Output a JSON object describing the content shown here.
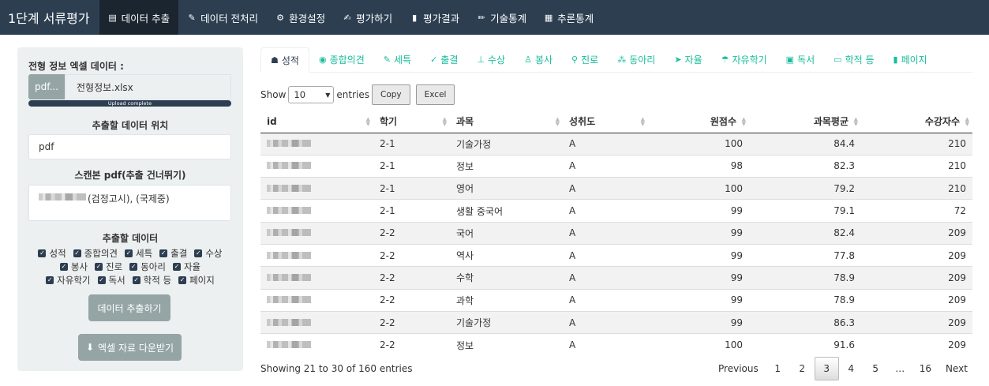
{
  "navbar": {
    "brand": "1단계 서류평가",
    "items": [
      {
        "label": "데이터 추출",
        "icon": "database-icon",
        "glyph": "▤"
      },
      {
        "label": "데이터 전처리",
        "icon": "magic-icon",
        "glyph": "✎"
      },
      {
        "label": "환경설정",
        "icon": "gears-icon",
        "glyph": "⚙"
      },
      {
        "label": "평가하기",
        "icon": "file-signature-icon",
        "glyph": "✍"
      },
      {
        "label": "평가결과",
        "icon": "book-icon",
        "glyph": "▮"
      },
      {
        "label": "기술통계",
        "icon": "pencil-icon",
        "glyph": "✏"
      },
      {
        "label": "추론통계",
        "icon": "chart-icon",
        "glyph": "▦"
      }
    ]
  },
  "sidebar": {
    "file_label": "전형 정보 엑셀 데이터 :",
    "file_button": "pdf...",
    "file_name": "전형정보.xlsx",
    "progress_text": "Upload complete",
    "location_label": "추출할 데이터 위치",
    "location_value": "pdf",
    "scan_label": "스캔본 pdf(추출 건너뛰기)",
    "scan_value": "(검정고시),  (국제중)",
    "extract_label": "추출할 데이터",
    "checkboxes_row1": [
      "성적",
      "종합의견",
      "세특",
      "출결",
      "수상"
    ],
    "checkboxes_row2": [
      "봉사",
      "진로",
      "동아리",
      "자율"
    ],
    "checkboxes_row3": [
      "자유학기",
      "독서",
      "학적 등",
      "페이지"
    ],
    "extract_button": "데이터 추출하기",
    "download_button": "엑셀 자료 다운받기"
  },
  "tabs": [
    {
      "label": "성적",
      "icon": "user-graduate-icon",
      "glyph": "☗"
    },
    {
      "label": "종합의견",
      "icon": "circle-user-icon",
      "glyph": "◉"
    },
    {
      "label": "세특",
      "icon": "edit-icon",
      "glyph": "✎"
    },
    {
      "label": "출결",
      "icon": "check-icon",
      "glyph": "✓"
    },
    {
      "label": "수상",
      "icon": "sitemap-icon",
      "glyph": "⊥"
    },
    {
      "label": "봉사",
      "icon": "hands-helping-icon",
      "glyph": "♙"
    },
    {
      "label": "진로",
      "icon": "route-icon",
      "glyph": "⚲"
    },
    {
      "label": "동아리",
      "icon": "users-icon",
      "glyph": "⁂"
    },
    {
      "label": "자율",
      "icon": "paper-plane-icon",
      "glyph": "➤"
    },
    {
      "label": "자유학기",
      "icon": "parachute-icon",
      "glyph": "☂"
    },
    {
      "label": "독서",
      "icon": "book-reader-icon",
      "glyph": "▣"
    },
    {
      "label": "학적 등",
      "icon": "id-card-icon",
      "glyph": "▭"
    },
    {
      "label": "페이지",
      "icon": "book-icon",
      "glyph": "▮"
    }
  ],
  "controls": {
    "show": "Show",
    "entries_value": "10",
    "entries": "entries",
    "copy": "Copy",
    "excel": "Excel"
  },
  "table": {
    "headers": [
      "id",
      "학기",
      "과목",
      "성취도",
      "원점수",
      "과목평균",
      "수강자수"
    ],
    "rows": [
      [
        "",
        "2-1",
        "기술가정",
        "A",
        "100",
        "84.4",
        "210"
      ],
      [
        "",
        "2-1",
        "정보",
        "A",
        "98",
        "82.3",
        "210"
      ],
      [
        "",
        "2-1",
        "영어",
        "A",
        "100",
        "79.2",
        "210"
      ],
      [
        "",
        "2-1",
        "생활 중국어",
        "A",
        "99",
        "79.1",
        "72"
      ],
      [
        "",
        "2-2",
        "국어",
        "A",
        "99",
        "82.4",
        "209"
      ],
      [
        "",
        "2-2",
        "역사",
        "A",
        "99",
        "77.8",
        "209"
      ],
      [
        "",
        "2-2",
        "수학",
        "A",
        "99",
        "78.9",
        "209"
      ],
      [
        "",
        "2-2",
        "과학",
        "A",
        "99",
        "78.9",
        "209"
      ],
      [
        "",
        "2-2",
        "기술가정",
        "A",
        "99",
        "86.3",
        "209"
      ],
      [
        "",
        "2-2",
        "정보",
        "A",
        "100",
        "91.6",
        "209"
      ]
    ]
  },
  "footer": {
    "info": "Showing 21 to 30 of 160 entries",
    "pages": [
      "Previous",
      "1",
      "2",
      "3",
      "4",
      "5",
      "…",
      "16",
      "Next"
    ],
    "current_page": "3"
  },
  "colors": {
    "navbar": "#2c3e50",
    "accent": "#18bc9c",
    "sidebar_bg": "#ecf0f1",
    "button_gray": "#95a5a6"
  }
}
